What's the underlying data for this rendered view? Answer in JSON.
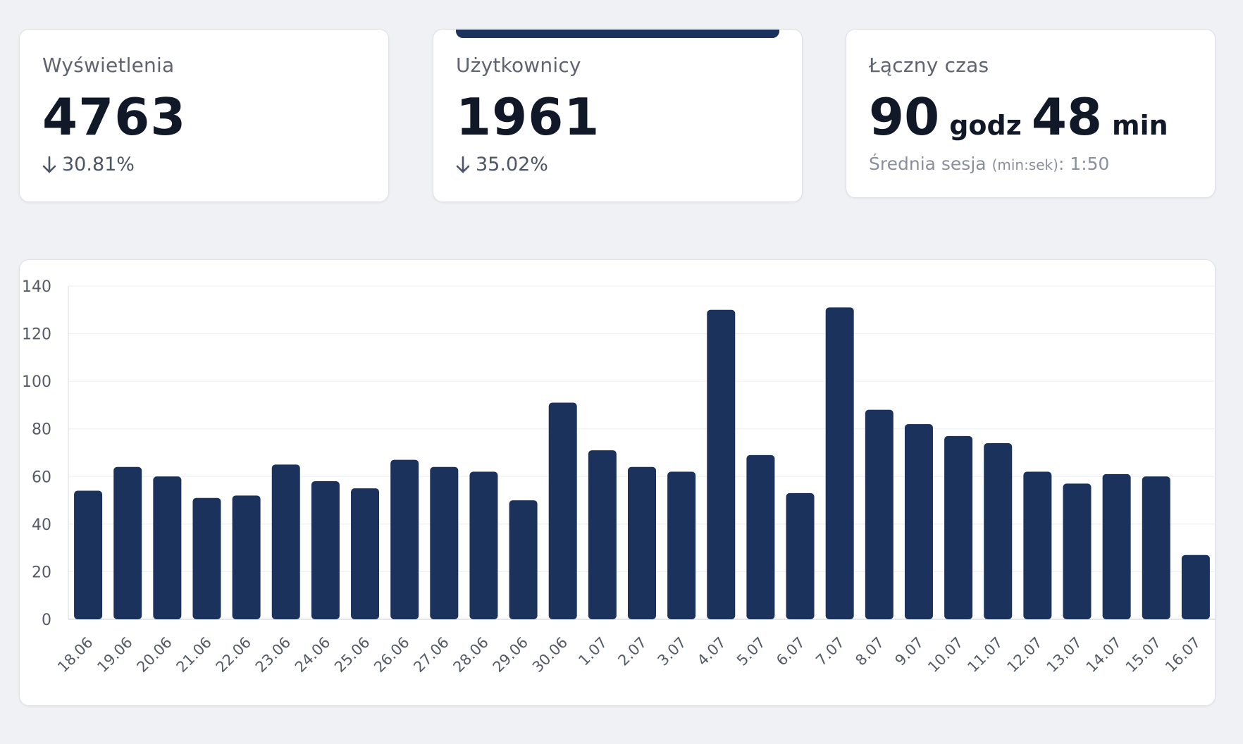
{
  "stats": {
    "views": {
      "label": "Wyświetlenia",
      "value": "4763",
      "change": "30.81%"
    },
    "users": {
      "label": "Użytkownicy",
      "value": "1961",
      "change": "35.02%"
    },
    "time": {
      "label": "Łączny czas",
      "hours": "90",
      "hours_unit": "godz",
      "minutes": "48",
      "minutes_unit": "min",
      "avg_label": "Średnia sesja",
      "avg_unit": "(min:sek)",
      "avg_value": ": 1:50"
    }
  },
  "colors": {
    "bar": "#1b335c",
    "accent": "#1b335c",
    "grid": "#eceef2",
    "axis_text": "#555b66"
  },
  "icons": {
    "change": "arrow-down-icon"
  },
  "chart_data": {
    "type": "bar",
    "categories": [
      "18.06",
      "19.06",
      "20.06",
      "21.06",
      "22.06",
      "23.06",
      "24.06",
      "25.06",
      "26.06",
      "27.06",
      "28.06",
      "29.06",
      "30.06",
      "1.07",
      "2.07",
      "3.07",
      "4.07",
      "5.07",
      "6.07",
      "7.07",
      "8.07",
      "9.07",
      "10.07",
      "11.07",
      "12.07",
      "13.07",
      "14.07",
      "15.07",
      "16.07"
    ],
    "values": [
      54,
      64,
      60,
      51,
      52,
      65,
      58,
      55,
      67,
      64,
      62,
      50,
      91,
      71,
      64,
      62,
      130,
      69,
      53,
      131,
      88,
      82,
      77,
      74,
      62,
      57,
      61,
      60,
      27
    ],
    "yticks": [
      0,
      20,
      40,
      60,
      80,
      100,
      120,
      140
    ],
    "ylim": [
      0,
      140
    ],
    "grid": true,
    "legend": "none"
  }
}
